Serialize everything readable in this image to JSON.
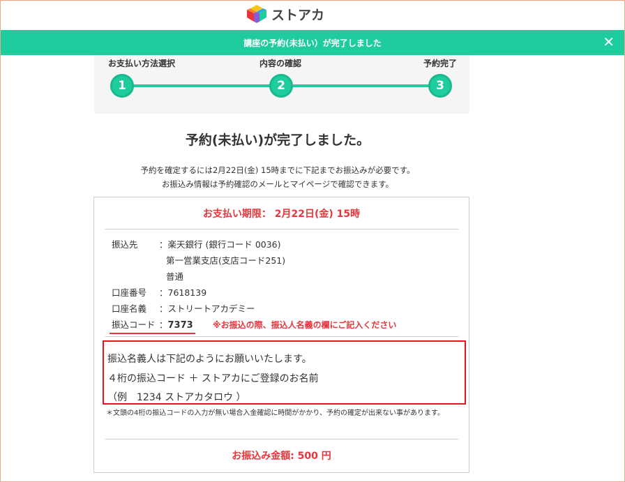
{
  "header": {
    "logo_text": "ストアカ",
    "logo_icon": "colorful-cube-logo-icon"
  },
  "banner": {
    "message": "講座の予約(未払い）が完了しました",
    "close_label": "✕",
    "background": "#1fcc9e"
  },
  "steps": [
    {
      "label": "お支払い方法選択",
      "number": "1"
    },
    {
      "label": "内容の確認",
      "number": "2"
    },
    {
      "label": "予約完了",
      "number": "3"
    }
  ],
  "main": {
    "title": "予約(未払い)が完了しました。",
    "intro_line1": "予約を確定するには2月22日(金) 15時までに下記までお振込みが必要です。",
    "intro_line2": "お振込み情報は予約確認のメールとマイページで確認できます。"
  },
  "payment": {
    "deadline": "お支払い期限： 2月22日(金) 15時",
    "transfer_to_label": "振込先",
    "transfer_to_lines": [
      "：楽天銀行 (銀行コード 0036)",
      "第一営業支店(支店コード251)",
      "普通"
    ],
    "account_number_label": "口座番号",
    "account_number_value": "：7618139",
    "account_name_label": "口座名義",
    "account_name_value": "：ストリートアカデミー",
    "code_label": "振込コード",
    "code_prefix": "：",
    "code_value": "7373",
    "code_note": "※お振込の際、振込人名義の欄にご記入ください",
    "box_line1": "振込名義人は下記のようにお願いいたします。",
    "box_line2": "４桁の振込コード ＋ ストアカにご登録のお名前",
    "box_line3": "（例　1234 ストアカタロウ ）",
    "small_note": "＊文頭の4桁の振込コードの入力が無い場合入金確認に時間がかかり、予約の確定が出来ない事があります。",
    "amount": "お振込み金額: 500 円"
  },
  "colors": {
    "accent": "#1fcc9e",
    "alert": "#e8343b"
  }
}
